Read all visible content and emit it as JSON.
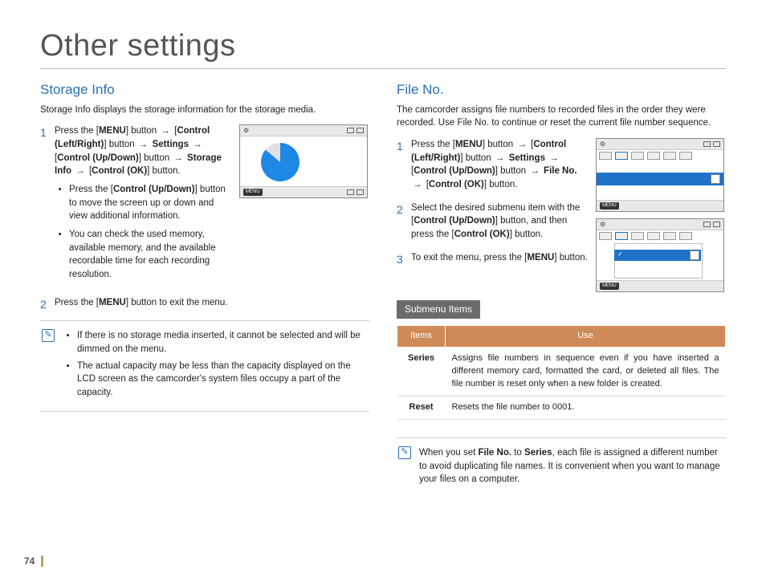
{
  "page_number": "74",
  "title": "Other settings",
  "left": {
    "heading": "Storage Info",
    "intro": "Storage Info displays the storage information for the storage media.",
    "step1_prefix": "Press the [",
    "menu": "MENU",
    "step1_after1": "] button",
    "arrow": "→",
    "ctrl_lr": "Control (Left/Right)",
    "step1_after2": "] button",
    "settings": "Settings",
    "ctrl_ud": "Control (Up/Down)",
    "step1_after3": "] button",
    "storage_info": "Storage Info",
    "ctrl_ok": "Control (OK)",
    "step1_end": "] button.",
    "bullet1a": "Press the [",
    "bullet1b": "] button to move the screen up or down and view additional information.",
    "bullet2": "You can check the used memory, available memory, and the available recordable time for each recording resolution.",
    "step2": "Press the [",
    "step2_end": "] button to exit the menu.",
    "note1": "If there is no storage media inserted, it cannot be selected and will be dimmed on the menu.",
    "note2": "The actual capacity may be less than the capacity displayed on the LCD screen as the camcorder's system files occupy a part of the capacity."
  },
  "right": {
    "heading": "File No.",
    "intro": "The camcorder assigns file numbers to recorded files in the order they were recorded. Use File No. to continue or reset the current file number sequence.",
    "step1_prefix": "Press the [",
    "menu": "MENU",
    "step1_after1": "] button",
    "ctrl_lr": "Control (Left/Right)",
    "step1_after2": "] button",
    "settings": "Settings",
    "ctrl_ud": "Control (Up/Down)",
    "step1_after3": "] button",
    "file_no": "File No.",
    "ctrl_ok": "Control (OK)",
    "step1_end": "] button.",
    "step2a": "Select the desired submenu item with the [",
    "step2b": "] button, and then press the [",
    "step2c": "] button.",
    "step3a": "To exit the menu, press the [",
    "step3b": "] button.",
    "subhead": "Submenu Items",
    "th_items": "Items",
    "th_use": "Use",
    "row1_k": "Series",
    "row1_v": "Assigns file numbers in sequence even if you have inserted a different memory card, formatted the card, or deleted all files. The file number is reset only when a new folder is created.",
    "row2_k": "Reset",
    "row2_v": "Resets the file number to 0001.",
    "note_a": "When you set ",
    "note_b": " to ",
    "note_c": ", each file is assigned a different number to avoid duplicating file names. It is convenient when you want to manage your files on a computer.",
    "note_file_no": "File No.",
    "note_series": "Series"
  },
  "icons": {
    "gear": "⚙",
    "note": "✎",
    "menu_label": "MENU"
  }
}
